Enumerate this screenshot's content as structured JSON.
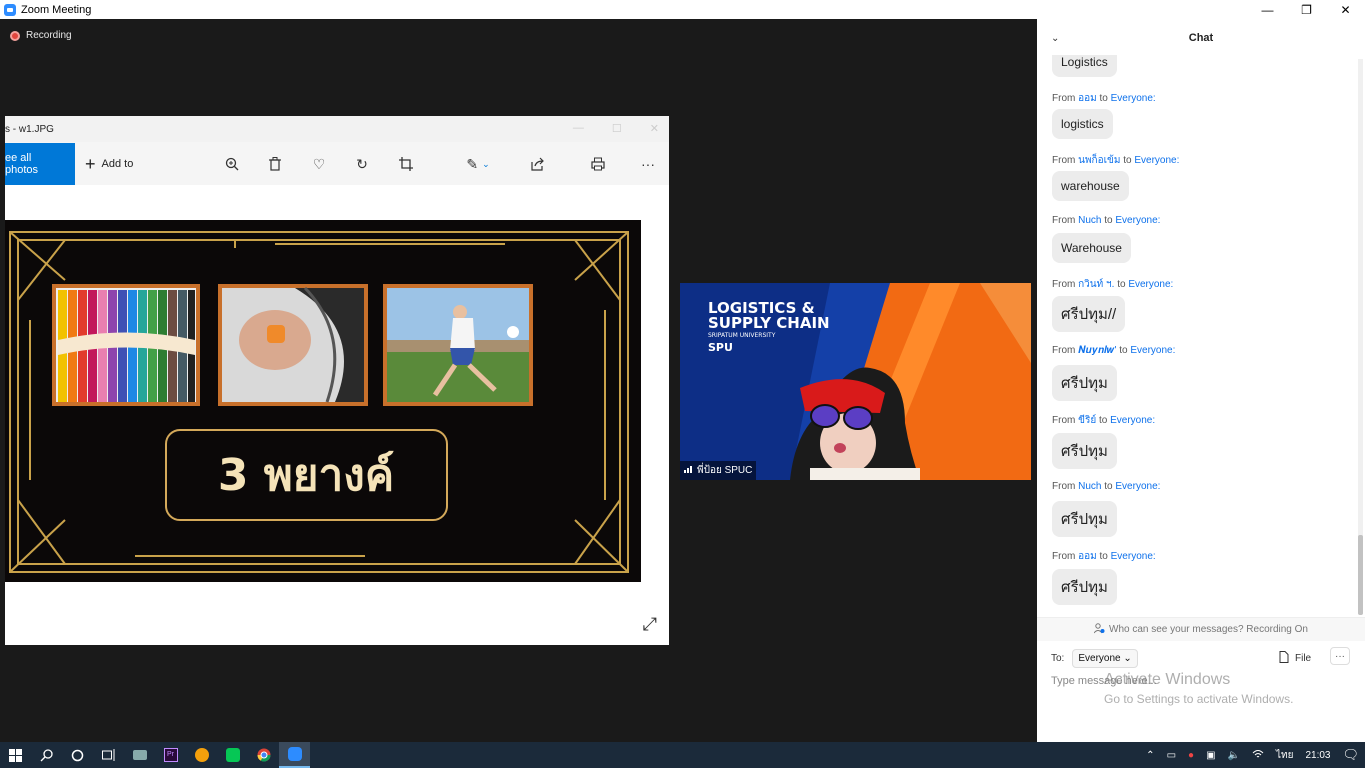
{
  "window": {
    "title": "Zoom Meeting",
    "min": "—",
    "max": "❐",
    "close": "✕"
  },
  "recording": {
    "label": "Recording"
  },
  "photos": {
    "title": "s - w1.JPG",
    "see_all": "ee all photos",
    "add_to": "Add to",
    "slide_text": "3 พยางค์"
  },
  "participant": {
    "name": "พี่ป้อย SPUC",
    "banner_title_1": "LOGISTICS &",
    "banner_title_2": "SUPPLY CHAIN",
    "banner_sub": "SRIPATUM UNIVERSITY",
    "banner_logo": "SPU"
  },
  "chat": {
    "title": "Chat",
    "first_bubble": "Logistics",
    "messages": [
      {
        "from_label": "From",
        "sender": "ออม",
        "to_label": "to",
        "recipient": "Everyone:",
        "text": "logistics"
      },
      {
        "from_label": "From",
        "sender": "นพก็อเข้ม",
        "to_label": "to",
        "recipient": "Everyone:",
        "text": "warehouse"
      },
      {
        "from_label": "From",
        "sender": "Nuch",
        "to_label": "to",
        "recipient": "Everyone:",
        "text": "Warehouse"
      },
      {
        "from_label": "From",
        "sender": "กวินท์ ฯ.",
        "to_label": "to",
        "recipient": "Everyone:",
        "text": "ศรีปทุม//"
      },
      {
        "from_label": "From",
        "sender": "𝑵𝒖𝒚𝒏𝒍𝒘'",
        "to_label": "to",
        "recipient": "Everyone:",
        "text": "ศรีปทุม"
      },
      {
        "from_label": "From",
        "sender": "ขีริย์",
        "to_label": "to",
        "recipient": "Everyone:",
        "text": "ศรีปทุม"
      },
      {
        "from_label": "From",
        "sender": "Nuch",
        "to_label": "to",
        "recipient": "Everyone:",
        "text": "ศรีปทุม"
      },
      {
        "from_label": "From",
        "sender": "ออม",
        "to_label": "to",
        "recipient": "Everyone:",
        "text": "ศรีปทุม"
      }
    ],
    "privacy": "Who can see your messages? Recording On",
    "to_label": "To:",
    "to_value": "Everyone",
    "file_label": "File",
    "more": "···",
    "placeholder": "Type message here..."
  },
  "watermark": {
    "line1": "Activate Windows",
    "line2": "Go to Settings to activate Windows."
  },
  "taskbar": {
    "time": "21:03",
    "lang": "ไทย"
  }
}
